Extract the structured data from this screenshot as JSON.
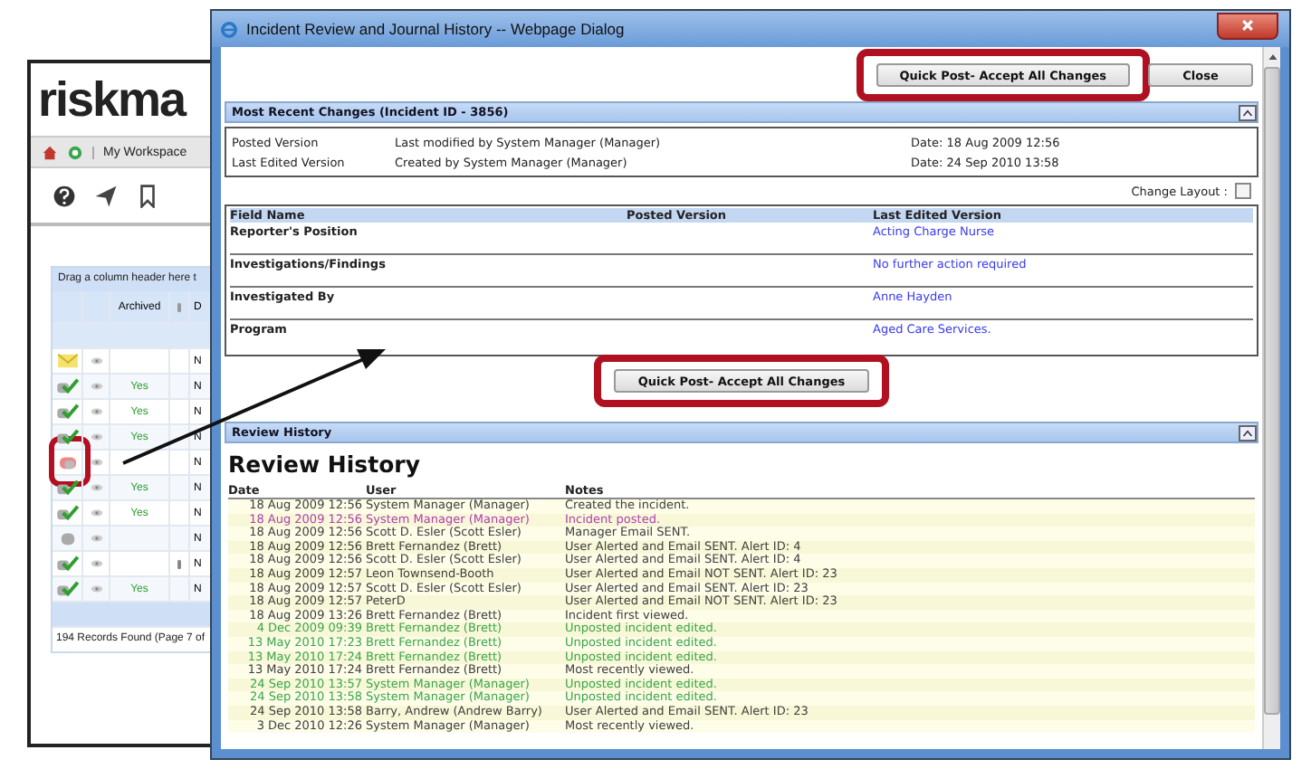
{
  "background_app": {
    "logo": "riskma",
    "toolbar": {
      "workspace": "My Workspace"
    },
    "grid": {
      "group_hint": "Drag a column header here t",
      "columns": [
        "Archived",
        "D"
      ],
      "rows": [
        {
          "kind": "mail",
          "archived": "",
          "attachment": false,
          "column_d": "N",
          "highlighted": false
        },
        {
          "kind": "posted",
          "archived": "Yes",
          "attachment": false,
          "column_d": "N",
          "highlighted": false
        },
        {
          "kind": "posted",
          "archived": "Yes",
          "attachment": false,
          "column_d": "N",
          "highlighted": false
        },
        {
          "kind": "posted",
          "archived": "Yes",
          "attachment": false,
          "column_d": "N",
          "highlighted": false
        },
        {
          "kind": "alert",
          "archived": "",
          "attachment": false,
          "column_d": "N",
          "highlighted": true
        },
        {
          "kind": "posted",
          "archived": "Yes",
          "attachment": false,
          "column_d": "N",
          "highlighted": false
        },
        {
          "kind": "posted",
          "archived": "Yes",
          "attachment": false,
          "column_d": "N",
          "highlighted": false
        },
        {
          "kind": "unposted",
          "archived": "",
          "attachment": false,
          "column_d": "N",
          "highlighted": false
        },
        {
          "kind": "posted",
          "archived": "",
          "attachment": true,
          "column_d": "N",
          "highlighted": false
        },
        {
          "kind": "posted",
          "archived": "Yes",
          "attachment": false,
          "column_d": "N",
          "highlighted": false
        }
      ],
      "footer": "194 Records Found (Page 7 of"
    }
  },
  "dialog": {
    "title": "Incident Review and Journal History -- Webpage Dialog",
    "top_buttons": [
      {
        "label": "Quick Post- Accept All Changes",
        "highlighted": true
      },
      {
        "label": "Close",
        "highlighted": false
      }
    ],
    "recent_changes": {
      "title": "Most Recent Changes (Incident ID - 3856)",
      "versions": [
        {
          "label": "Posted Version",
          "detail": "Last modified by System Manager (Manager)",
          "date": "Date: 18 Aug 2009 12:56"
        },
        {
          "label": "Last Edited Version",
          "detail": "Created by System Manager (Manager)",
          "date": "Date: 24 Sep 2010 13:58"
        }
      ],
      "change_layout": {
        "label": "Change Layout :",
        "checked": false
      },
      "table": {
        "columns": [
          "Field Name",
          "Posted Version",
          "Last Edited Version"
        ],
        "rows": [
          {
            "field": "Reporter's Position",
            "edited": "Acting Charge Nurse"
          },
          {
            "field": "Investigations/Findings",
            "edited": "No further action required"
          },
          {
            "field": "Investigated By",
            "edited": "Anne Hayden"
          },
          {
            "field": "Program",
            "edited": "Aged Care Services."
          }
        ]
      },
      "bottom_button": {
        "label": "Quick Post- Accept All Changes",
        "highlighted": true
      }
    },
    "review_history": {
      "bar_title": "Review History",
      "heading": "Review History",
      "columns": [
        "Date",
        "User",
        "Notes"
      ],
      "rows": [
        {
          "date": "18 Aug 2009 12:56",
          "user": "System Manager (Manager)",
          "notes": "Created the incident.",
          "color": "#404040"
        },
        {
          "date": "18 Aug 2009 12:56",
          "user": "System Manager (Manager)",
          "notes": "Incident posted.",
          "color": "#b040b0"
        },
        {
          "date": "18 Aug 2009 12:56",
          "user": "Scott D. Esler (Scott Esler)",
          "notes": "Manager Email SENT.",
          "color": "#404040"
        },
        {
          "date": "18 Aug 2009 12:56",
          "user": "Brett Fernandez (Brett)",
          "notes": "User Alerted and Email SENT. Alert ID: 4",
          "color": "#404040"
        },
        {
          "date": "18 Aug 2009 12:56",
          "user": "Scott D. Esler (Scott Esler)",
          "notes": "User Alerted and Email SENT. Alert ID: 4",
          "color": "#404040"
        },
        {
          "date": "18 Aug 2009 12:57",
          "user": "Leon Townsend-Booth",
          "notes": "User Alerted and Email NOT SENT. Alert ID: 23",
          "color": "#404040"
        },
        {
          "date": "18 Aug 2009 12:57",
          "user": "Scott D. Esler (Scott Esler)",
          "notes": "User Alerted and Email SENT. Alert ID: 23",
          "color": "#404040"
        },
        {
          "date": "18 Aug 2009 12:57",
          "user": "PeterD",
          "notes": "User Alerted and Email NOT SENT. Alert ID: 23",
          "color": "#404040"
        },
        {
          "date": "18 Aug 2009 13:26",
          "user": "Brett Fernandez (Brett)",
          "notes": "Incident first viewed.",
          "color": "#404040"
        },
        {
          "date": "4 Dec 2009 09:39",
          "user": "Brett Fernandez (Brett)",
          "notes": "Unposted incident edited.",
          "color": "#3aa64a"
        },
        {
          "date": "13 May 2010 17:23",
          "user": "Brett Fernandez (Brett)",
          "notes": "Unposted incident edited.",
          "color": "#3aa64a"
        },
        {
          "date": "13 May 2010 17:24",
          "user": "Brett Fernandez (Brett)",
          "notes": "Unposted incident edited.",
          "color": "#3aa64a"
        },
        {
          "date": "13 May 2010 17:24",
          "user": "Brett Fernandez (Brett)",
          "notes": "Most recently viewed.",
          "color": "#404040"
        },
        {
          "date": "24 Sep 2010 13:57",
          "user": "System Manager (Manager)",
          "notes": "Unposted incident edited.",
          "color": "#3aa64a"
        },
        {
          "date": "24 Sep 2010 13:58",
          "user": "System Manager (Manager)",
          "notes": "Unposted incident edited.",
          "color": "#3aa64a"
        },
        {
          "date": "24 Sep 2010 13:58",
          "user": "Barry, Andrew (Andrew Barry)",
          "notes": "User Alerted and Email SENT. Alert ID: 23",
          "color": "#404040"
        },
        {
          "date": "3 Dec 2010 12:26",
          "user": "System Manager (Manager)",
          "notes": "Most recently viewed.",
          "color": "#404040"
        }
      ]
    }
  }
}
